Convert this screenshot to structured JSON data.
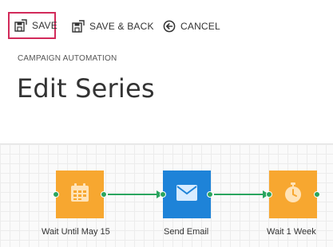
{
  "toolbar": {
    "save_label": "SAVE",
    "save_back_label": "SAVE & BACK",
    "cancel_label": "CANCEL"
  },
  "breadcrumb": "CAMPAIGN AUTOMATION",
  "page_title": "Edit Series",
  "workflow": {
    "steps": [
      {
        "label": "Wait Until May 15",
        "icon": "calendar-icon",
        "color": "#f7a730"
      },
      {
        "label": "Send Email",
        "icon": "envelope-icon",
        "color": "#1e83d8"
      },
      {
        "label": "Wait 1 Week",
        "icon": "stopwatch-icon",
        "color": "#f7a730"
      }
    ],
    "connector_color": "#2aa55f",
    "highlight_color": "#d22a5a"
  }
}
